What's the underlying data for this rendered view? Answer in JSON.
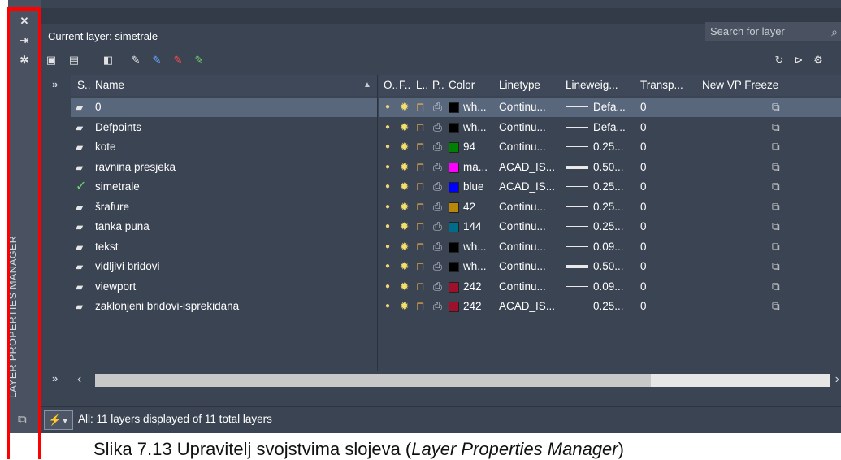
{
  "window": {
    "vertical_title": "LAYER PROPERTIES MANAGER",
    "current_layer_label": "Current layer: simetrale",
    "search_placeholder": "Search for layer"
  },
  "columns": {
    "status": "S..",
    "name": "Name",
    "on": "O..",
    "freeze": "F..",
    "lock": "L..",
    "plot": "P..",
    "color": "Color",
    "linetype": "Linetype",
    "lineweight": "Lineweig...",
    "transparency": "Transp...",
    "new_vp_freeze": "New VP Freeze"
  },
  "layers": [
    {
      "name": "0",
      "color_label": "wh...",
      "color_hex": "#000000",
      "linetype": "Continu...",
      "lineweight": "Defa...",
      "lw_thick": false,
      "transp": "0",
      "selected": true,
      "current": false
    },
    {
      "name": "Defpoints",
      "color_label": "wh...",
      "color_hex": "#000000",
      "linetype": "Continu...",
      "lineweight": "Defa...",
      "lw_thick": false,
      "transp": "0",
      "selected": false,
      "current": false
    },
    {
      "name": "kote",
      "color_label": "94",
      "color_hex": "#008000",
      "linetype": "Continu...",
      "lineweight": "0.25...",
      "lw_thick": false,
      "transp": "0",
      "selected": false,
      "current": false
    },
    {
      "name": "ravnina presjeka",
      "color_label": "ma...",
      "color_hex": "#ff00ff",
      "linetype": "ACAD_IS...",
      "lineweight": "0.50...",
      "lw_thick": true,
      "transp": "0",
      "selected": false,
      "current": false
    },
    {
      "name": "simetrale",
      "color_label": "blue",
      "color_hex": "#0000ff",
      "linetype": "ACAD_IS...",
      "lineweight": "0.25...",
      "lw_thick": false,
      "transp": "0",
      "selected": false,
      "current": true
    },
    {
      "name": "šrafure",
      "color_label": "42",
      "color_hex": "#b8860b",
      "linetype": "Continu...",
      "lineweight": "0.25...",
      "lw_thick": false,
      "transp": "0",
      "selected": false,
      "current": false
    },
    {
      "name": "tanka puna",
      "color_label": "144",
      "color_hex": "#006c8a",
      "linetype": "Continu...",
      "lineweight": "0.25...",
      "lw_thick": false,
      "transp": "0",
      "selected": false,
      "current": false
    },
    {
      "name": "tekst",
      "color_label": "wh...",
      "color_hex": "#000000",
      "linetype": "Continu...",
      "lineweight": "0.09...",
      "lw_thick": false,
      "transp": "0",
      "selected": false,
      "current": false
    },
    {
      "name": "vidljivi bridovi",
      "color_label": "wh...",
      "color_hex": "#000000",
      "linetype": "Continu...",
      "lineweight": "0.50...",
      "lw_thick": true,
      "transp": "0",
      "selected": false,
      "current": false
    },
    {
      "name": "viewport",
      "color_label": "242",
      "color_hex": "#a0102a",
      "linetype": "Continu...",
      "lineweight": "0.09...",
      "lw_thick": false,
      "transp": "0",
      "selected": false,
      "current": false
    },
    {
      "name": "zaklonjeni bridovi-isprekidana",
      "color_label": "242",
      "color_hex": "#a0102a",
      "linetype": "ACAD_IS...",
      "lineweight": "0.25...",
      "lw_thick": false,
      "transp": "0",
      "selected": false,
      "current": false
    }
  ],
  "status": {
    "text": "All: 11 layers displayed of 11 total layers"
  },
  "caption": {
    "prefix": "Slika 7.13 Upravitelj svojstvima slojeva (",
    "italic": "Layer Properties Manager",
    "suffix": ")"
  }
}
